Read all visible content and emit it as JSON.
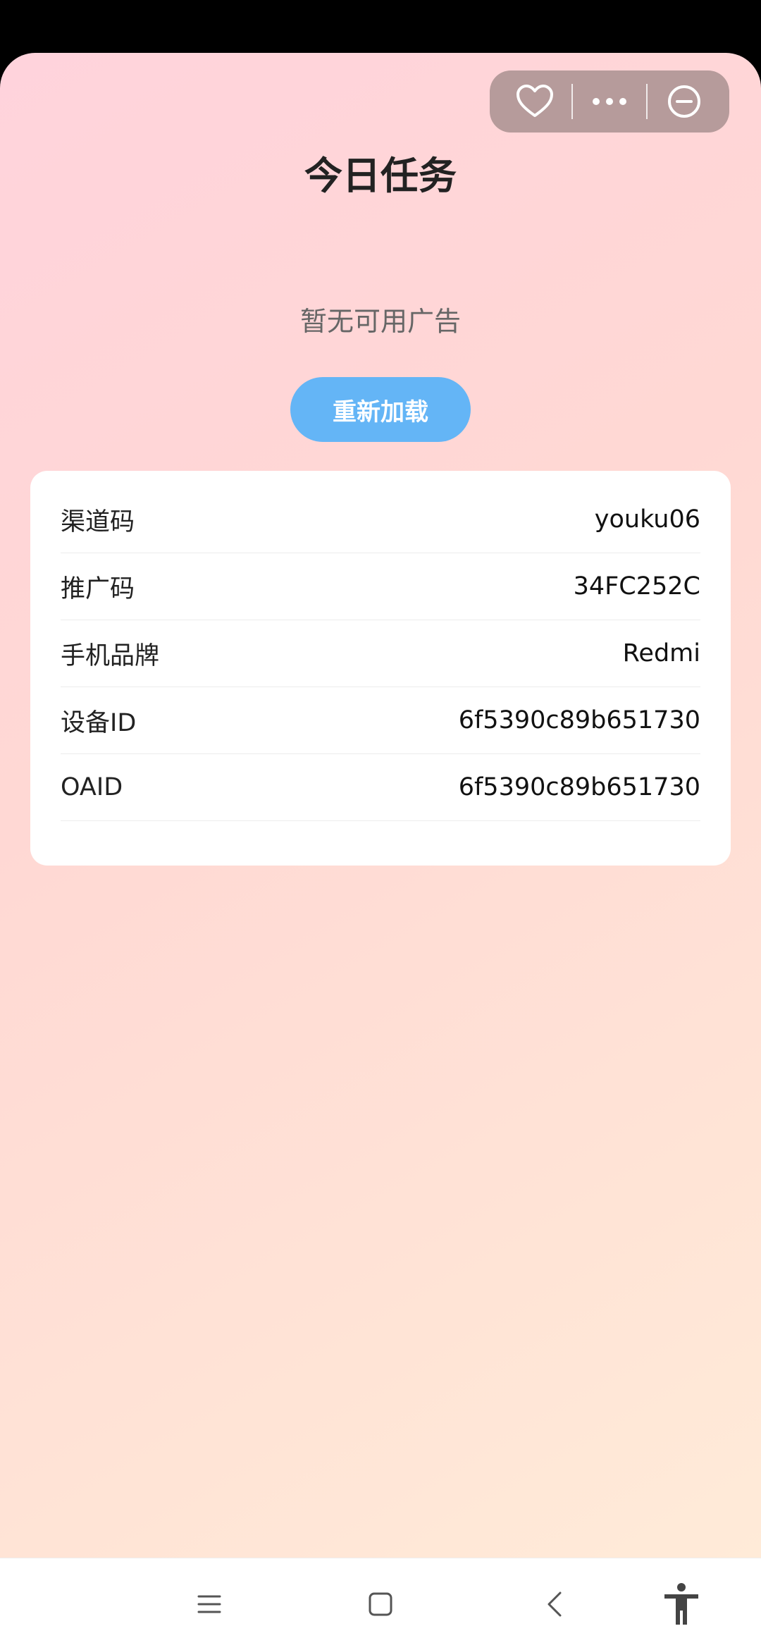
{
  "page": {
    "title": "今日任务",
    "empty_message": "暂无可用广告",
    "reload_label": "重新加载"
  },
  "capsule": {
    "favorite_icon": "heart-outline",
    "more_icon": "ellipsis",
    "close_icon": "minus-circle"
  },
  "info": {
    "rows": [
      {
        "key": "渠道码",
        "value": "youku06"
      },
      {
        "key": "推广码",
        "value": "34FC252C"
      },
      {
        "key": "手机品牌",
        "value": "Redmi"
      },
      {
        "key": "设备ID",
        "value": "6f5390c89b651730"
      },
      {
        "key": "OAID",
        "value": "6f5390c89b651730"
      }
    ]
  },
  "nav": {
    "menu_icon": "hamburger",
    "home_icon": "square",
    "back_icon": "chevron-left",
    "accessibility_icon": "accessibility-person"
  },
  "colors": {
    "accent": "#64b5f6",
    "capsule_bg": "#b69b9b",
    "gradient_start": "#ffd3dc",
    "gradient_end": "#ffebd8"
  }
}
